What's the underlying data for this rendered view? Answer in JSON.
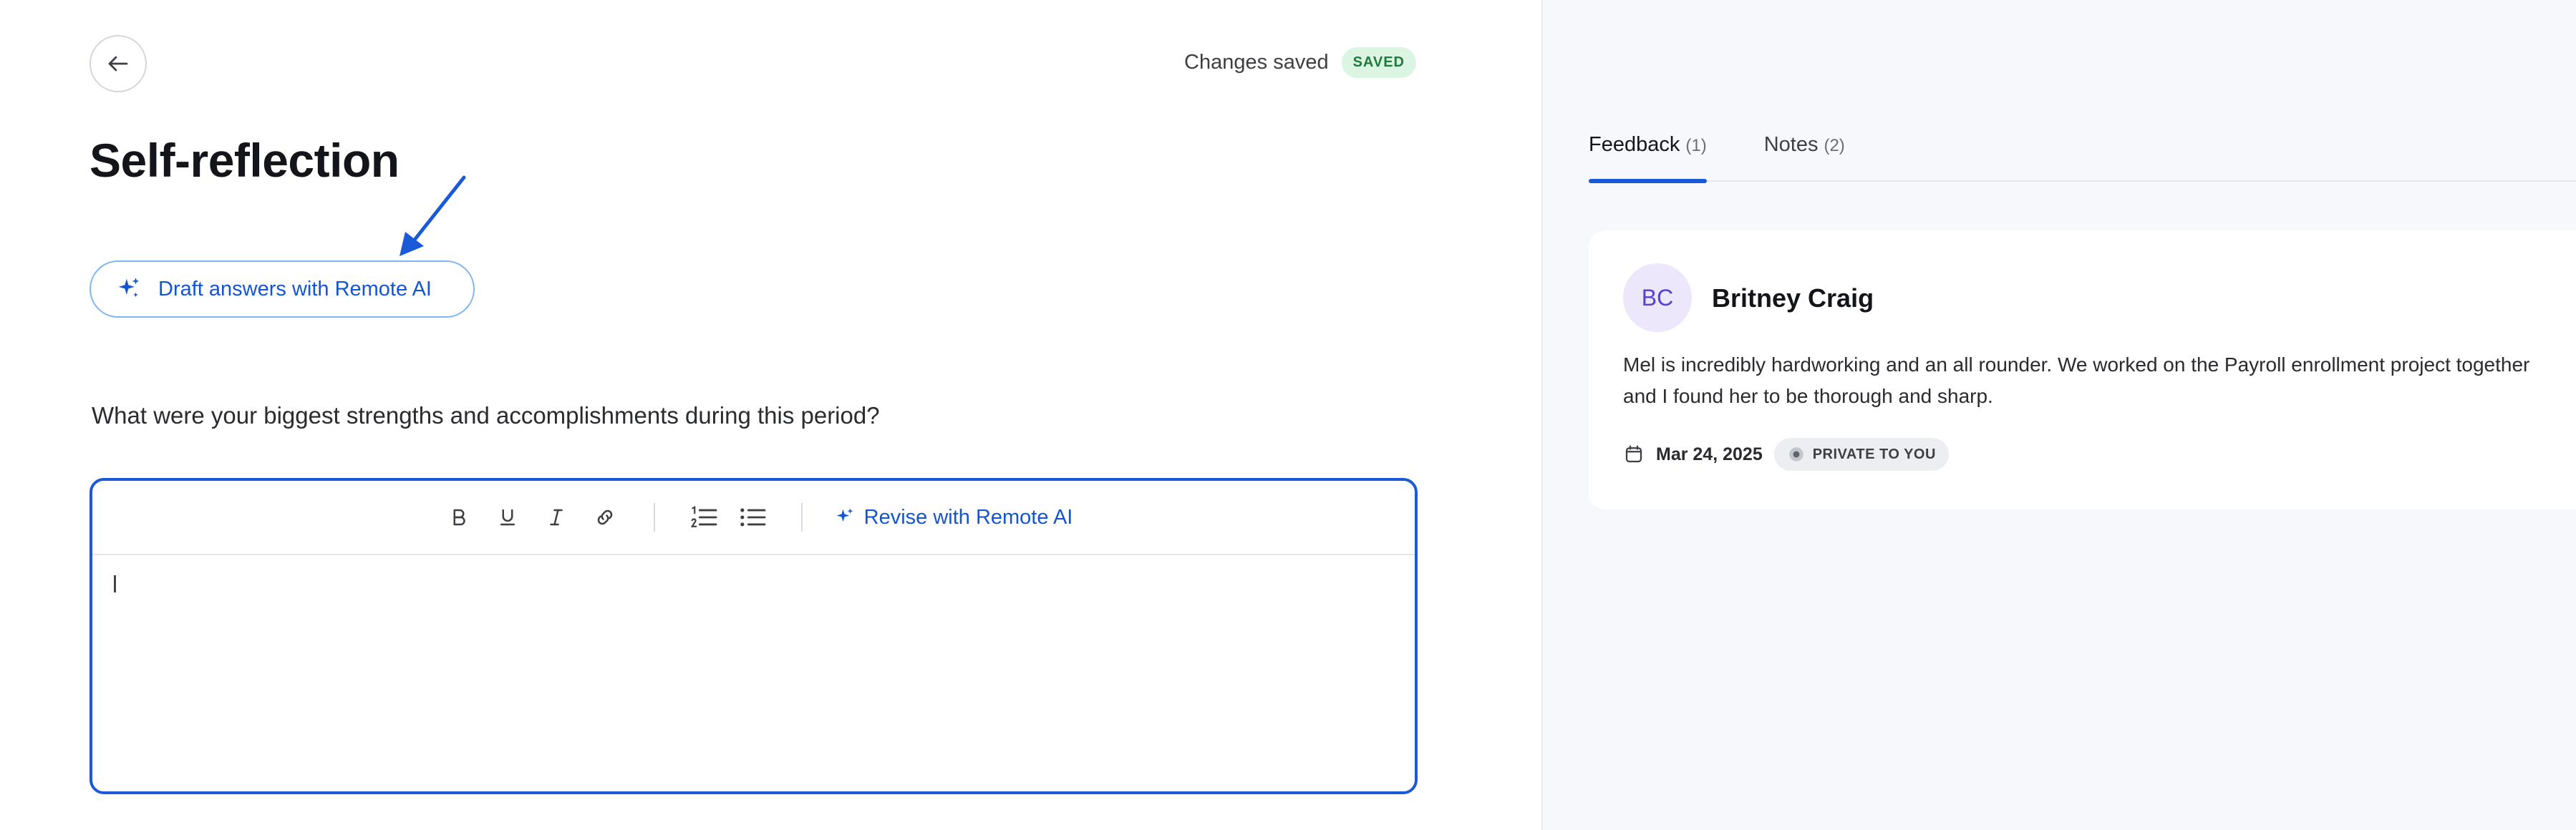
{
  "header": {
    "save_status_text": "Changes saved",
    "save_badge": "SAVED"
  },
  "page": {
    "title": "Self-reflection",
    "draft_button_label": "Draft answers with Remote AI"
  },
  "question": {
    "text": "What were your biggest strengths and accomplishments during this period?"
  },
  "editor": {
    "revise_label": "Revise with Remote AI",
    "tools": [
      "bold-icon",
      "underline-icon",
      "italic-icon",
      "link-icon",
      "numbered-list-icon",
      "bullet-list-icon"
    ],
    "value": ""
  },
  "tabs": [
    {
      "label": "Feedback",
      "count": "(1)",
      "active": true
    },
    {
      "label": "Notes",
      "count": "(2)",
      "active": false
    }
  ],
  "feedback": {
    "initials": "BC",
    "name": "Britney Craig",
    "text": "Mel is incredibly hardworking and an all rounder. We worked on the Payroll enrollment project together and I found her to be thorough and sharp.",
    "date": "Mar 24, 2025",
    "privacy": "PRIVATE TO YOU"
  },
  "colors": {
    "accent": "#1a5ad9",
    "saved_badge_bg": "#dcf5e3",
    "saved_badge_text": "#1e7a3b",
    "avatar_bg": "#ece7fb",
    "avatar_text": "#5b3fd1",
    "right_panel_bg": "#f6f8fb"
  }
}
